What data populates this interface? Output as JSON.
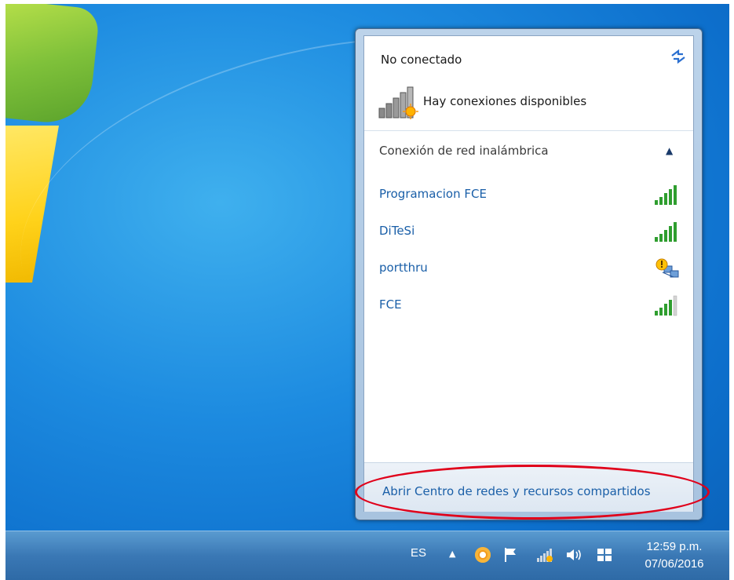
{
  "flyout": {
    "status_title": "No conectado",
    "available_text": "Hay conexiones disponibles",
    "group_header": "Conexión de red inalámbrica",
    "networks": [
      {
        "name": "Programacion FCE",
        "signal": "strong",
        "secured": false
      },
      {
        "name": "DiTeSi",
        "signal": "strong",
        "secured": false
      },
      {
        "name": "portthru",
        "signal": "warning",
        "secured": false
      },
      {
        "name": "FCE",
        "signal": "medium",
        "secured": false
      }
    ],
    "footer_link": "Abrir Centro de redes y recursos compartidos",
    "icons": {
      "refresh": "refresh-icon",
      "status": "network-signal-sun-icon",
      "collapse": "chevron-up-icon"
    }
  },
  "taskbar": {
    "language": "ES",
    "time": "12:59 p.m.",
    "date": "07/06/2016",
    "tray_icons": [
      "show-hidden-icons-arrow",
      "avast-icon",
      "action-center-flag-icon",
      "network-icon",
      "volume-icon",
      "windows-icon"
    ]
  },
  "colors": {
    "link": "#1a5fa8",
    "highlight": "#e0001a",
    "signal_green": "#2f9e2f"
  }
}
